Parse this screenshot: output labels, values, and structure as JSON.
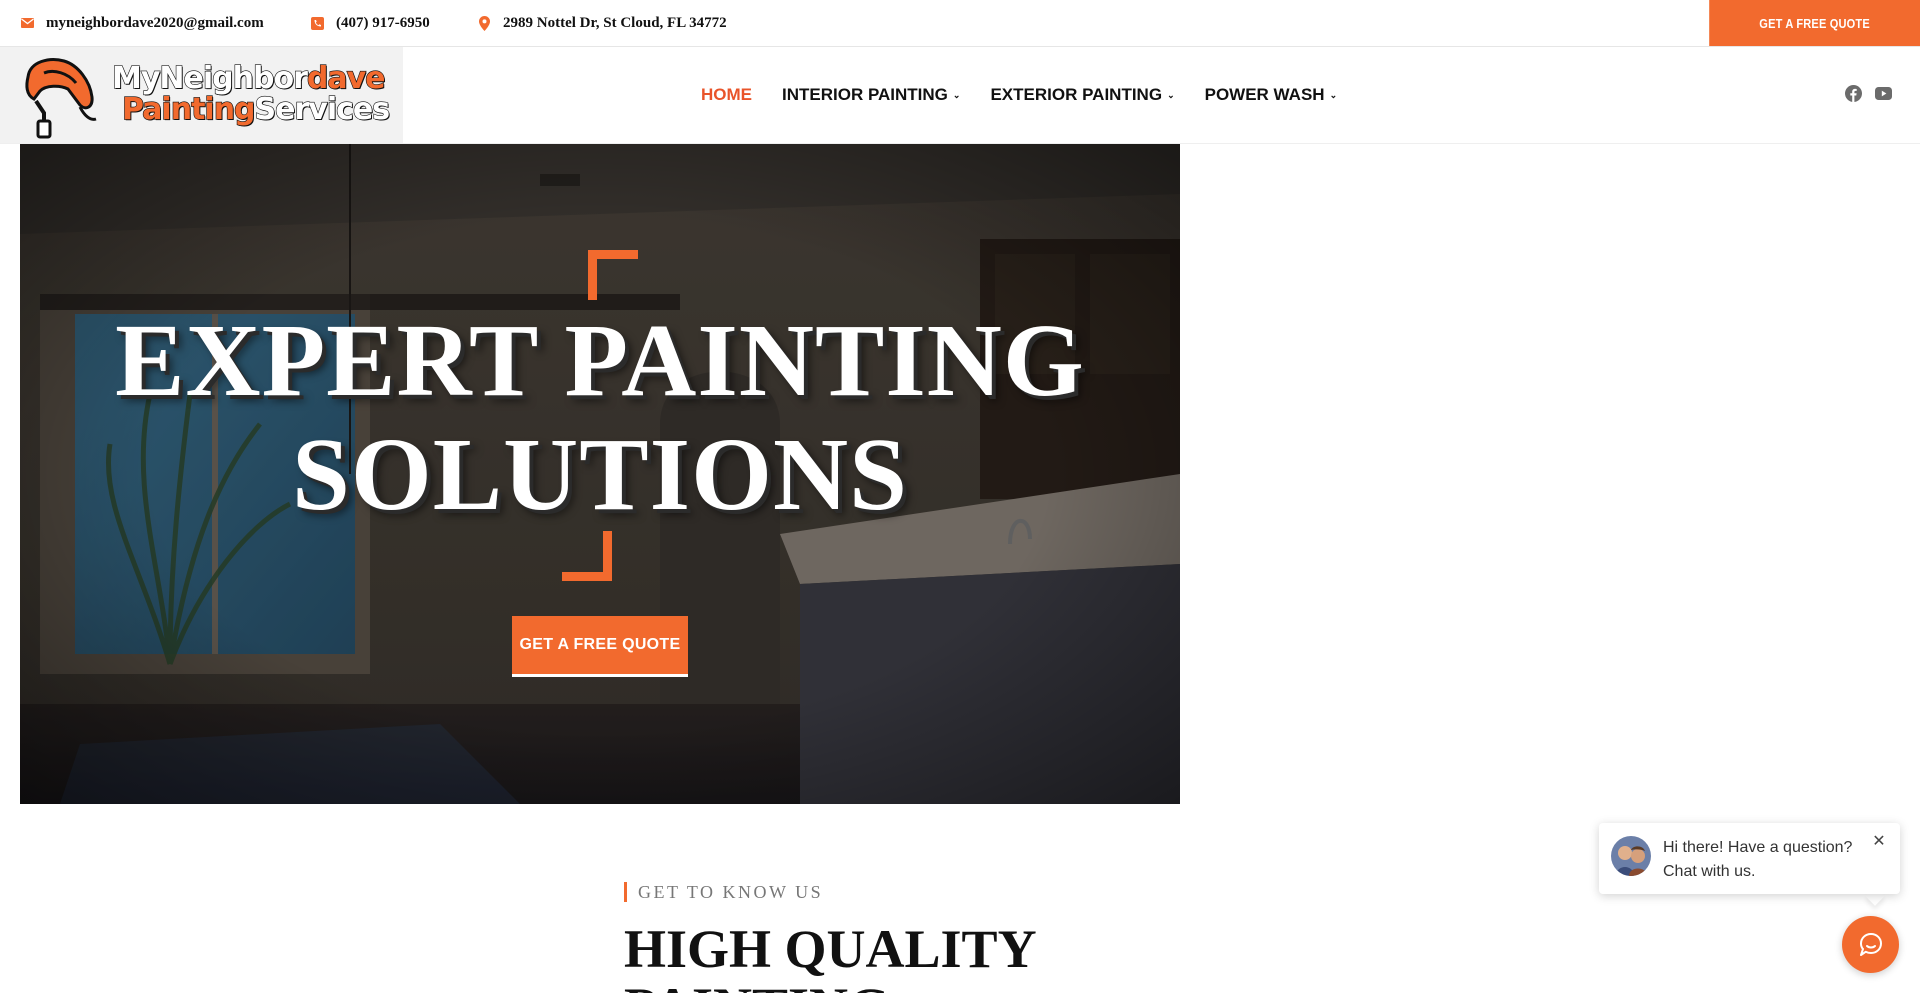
{
  "topbar": {
    "email": "myneighbordave2020@gmail.com",
    "phone": "(407) 917-6950",
    "address": "2989 Nottel Dr, St Cloud, FL 34772",
    "quote_button": "GET A FREE QUOTE",
    "email_icon": "envelope-icon",
    "phone_icon": "phone-icon",
    "address_icon": "map-pin-icon"
  },
  "logo": {
    "line1_white": "MyNeighbor",
    "line1_orange": "dave",
    "line2_orange": "Painting",
    "line2_white": "Services",
    "icon": "paint-roller-icon"
  },
  "nav": {
    "items": [
      {
        "label": "HOME",
        "active": true,
        "has_dropdown": false
      },
      {
        "label": "INTERIOR PAINTING",
        "active": false,
        "has_dropdown": true
      },
      {
        "label": "EXTERIOR PAINTING",
        "active": false,
        "has_dropdown": true
      },
      {
        "label": "POWER WASH",
        "active": false,
        "has_dropdown": true
      }
    ]
  },
  "social": {
    "icons": [
      "facebook-icon",
      "youtube-icon"
    ]
  },
  "hero": {
    "title_line1": "EXPERT PAINTING",
    "title_line2": "SOLUTIONS",
    "cta": "GET A FREE QUOTE"
  },
  "about": {
    "eyebrow": "GET TO KNOW US",
    "title": "HIGH QUALITY PAINTING"
  },
  "chat": {
    "message": "Hi there! Have a question? Chat with us.",
    "close_icon": "close-icon",
    "launcher_icon": "chat-icon"
  },
  "colors": {
    "accent": "#f26a2e",
    "nav_active": "#e9542a",
    "text": "#111111"
  }
}
